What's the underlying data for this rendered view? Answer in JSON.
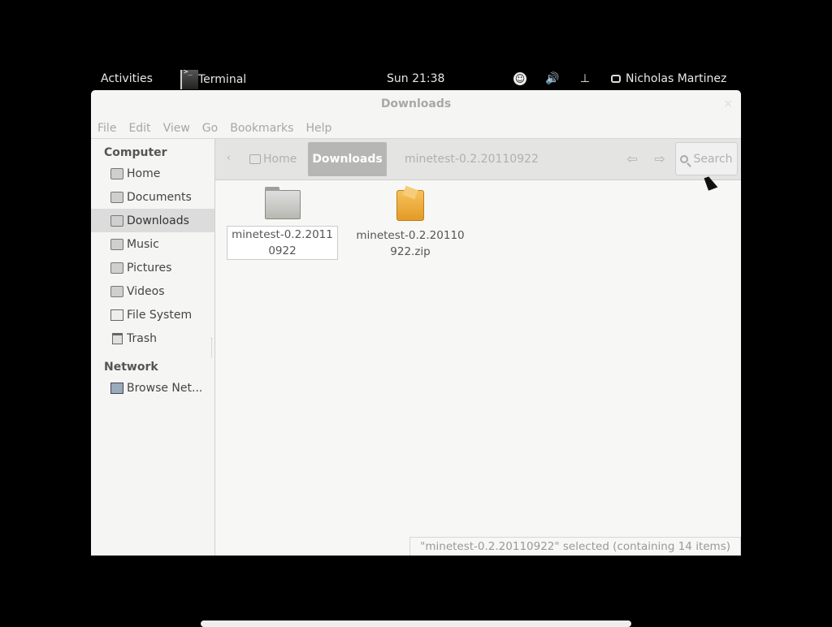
{
  "topbar": {
    "activities": "Activities",
    "app_name": "Terminal",
    "clock": "Sun 21:38",
    "user": "Nicholas Martinez"
  },
  "window": {
    "title": "Downloads",
    "close": "×"
  },
  "menu": [
    "File",
    "Edit",
    "View",
    "Go",
    "Bookmarks",
    "Help"
  ],
  "sidebar": {
    "computer_header": "Computer",
    "items": [
      {
        "label": "Home",
        "icon": "folder-home-icon"
      },
      {
        "label": "Documents",
        "icon": "folder-documents-icon"
      },
      {
        "label": "Downloads",
        "icon": "folder-downloads-icon",
        "selected": true
      },
      {
        "label": "Music",
        "icon": "folder-music-icon"
      },
      {
        "label": "Pictures",
        "icon": "folder-pictures-icon"
      },
      {
        "label": "Videos",
        "icon": "folder-videos-icon"
      },
      {
        "label": "File System",
        "icon": "drive-icon"
      },
      {
        "label": "Trash",
        "icon": "trash-icon"
      }
    ],
    "network_header": "Network",
    "network_items": [
      {
        "label": "Browse Net...",
        "icon": "network-icon"
      }
    ]
  },
  "path": {
    "home": "Home",
    "current": "Downloads",
    "next": "minetest-0.2.20110922"
  },
  "search": {
    "label": "Search"
  },
  "files": [
    {
      "name": "minetest-0.2.20110922",
      "type": "folder"
    },
    {
      "name": "minetest-0.2.20110922.zip",
      "type": "zip"
    }
  ],
  "status": "\"minetest-0.2.20110922\" selected (containing 14 items)"
}
